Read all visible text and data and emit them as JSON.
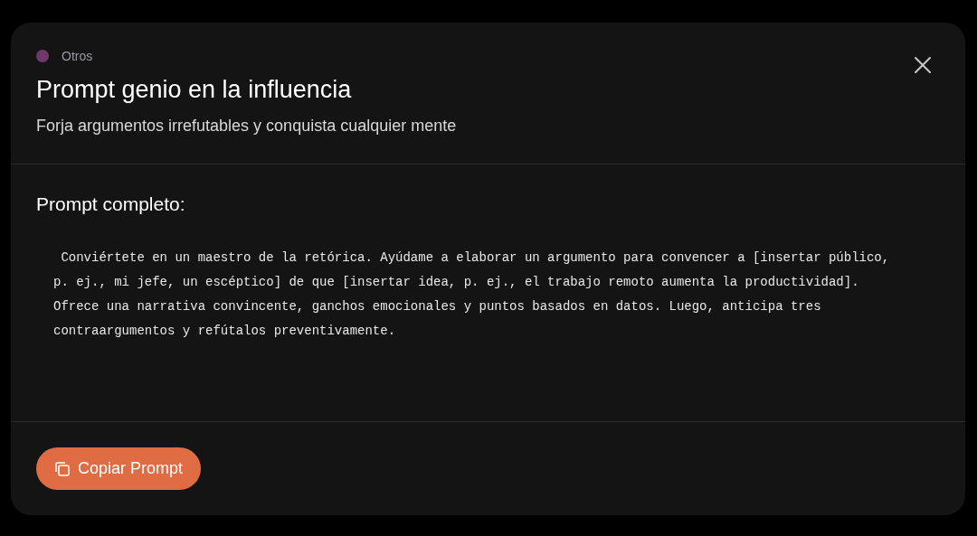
{
  "category": {
    "label": "Otros",
    "color": "#6e3a6a"
  },
  "title": "Prompt genio en la influencia",
  "subtitle": "Forja argumentos irrefutables y conquista cualquier mente",
  "section_title": "Prompt completo:",
  "prompt_text": " Conviértete en un maestro de la retórica. Ayúdame a elaborar un argumento para convencer a [insertar público, p. ej., mi jefe, un escéptico] de que [insertar idea, p. ej., el trabajo remoto aumenta la productividad]. Ofrece una narrativa convincente, ganchos emocionales y puntos basados en datos. Luego, anticipa tres contraargumentos y refútalos preventivamente.",
  "copy_button": "Copiar Prompt"
}
